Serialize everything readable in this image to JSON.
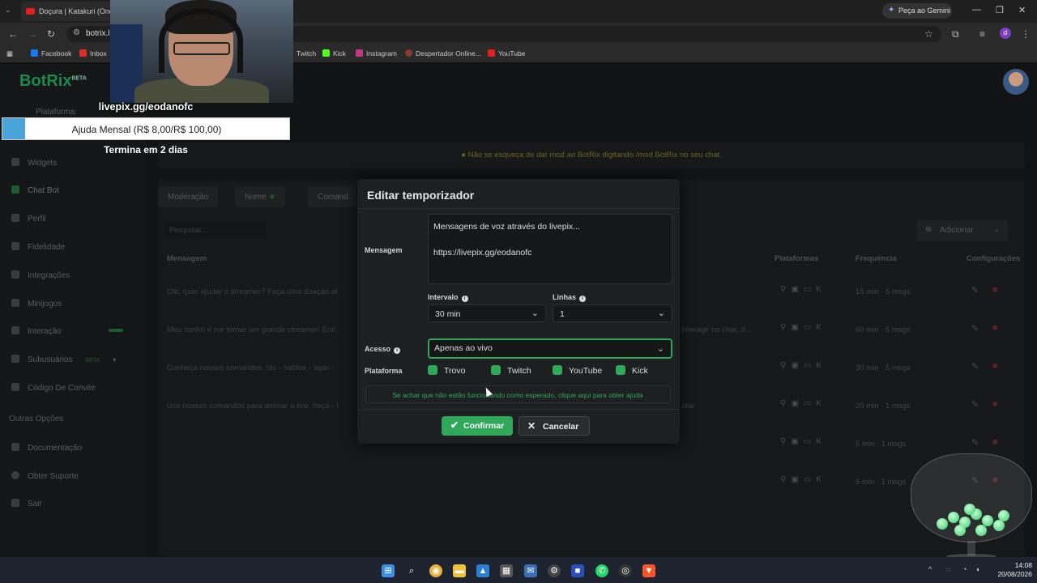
{
  "browser": {
    "tab_title": "Doçura | Katakuri (One P",
    "gemini_label": "Peça ao Gemini",
    "url": "botrix.li",
    "profile_initial": "d",
    "bookmarks": [
      "Facebook",
      "Inbox",
      "Twitch",
      "Kick",
      "Instagram",
      "Despertador Online...",
      "YouTube"
    ]
  },
  "overlay": {
    "livepix_label": "livepix.gg/eodanofc",
    "donation_goal": "Ajuda Mensal (R$ 8,00/R$ 100,00)",
    "donation_progress": 0.08,
    "ends_label": "Termina em 2 dias"
  },
  "app": {
    "logo": "BotRix",
    "logo_badge": "BETA",
    "platform_label": "Plataforma:",
    "sidebar": [
      "Widgets",
      "Chat Bot",
      "Perfil",
      "Fidelidade",
      "Integrações",
      "Minijogos",
      "Interação",
      "Subusuários",
      "Código De Convite"
    ],
    "subusers_badge": "BETA",
    "other_section": "Outras Opções",
    "other_items": [
      "Documentação",
      "Obter Suporte",
      "Sair"
    ],
    "banner": "Não se esqueça de dar mod ao BotRix digitando /mod BotRix no seu chat.",
    "tabs": [
      "Moderação",
      "Nome",
      "Comand"
    ],
    "search_placeholder": "Pesquisar...",
    "add_label": "Adicionar",
    "columns": [
      "Mensagem",
      "Plataformas",
      "Frequência",
      "Configurações"
    ],
    "rows": [
      {
        "msg": "Olá, quer ajudar o streamer? Faça uma doação at",
        "freq": "15 min · 5 msgs"
      },
      {
        "msg": "Meu sonho é me tornar um grande streamer! Entr",
        "extra": "interagir no chat, d...",
        "freq": "60 min · 5 msgs"
      },
      {
        "msg": "Conheça nossos comandos. !dc - !roblox - !epic -",
        "freq": "30 min · 5 msgs"
      },
      {
        "msg": "Use nossos comandos para animar a live. !roça - !",
        "extra": "afar",
        "freq": "20 min · 1 msgs"
      },
      {
        "msg": "",
        "freq": "5 min · 1 msgs"
      },
      {
        "msg": "",
        "freq": "5 min · 1 msgs"
      }
    ]
  },
  "modal": {
    "title": "Editar temporizador",
    "message_label": "Mensagem",
    "message_line1": "Mensagens de voz através do livepix...",
    "message_line2": "https://livepix.gg/eodanofc",
    "interval_label": "Intervalo",
    "interval_value": "30 min",
    "lines_label": "Linhas",
    "lines_value": "1",
    "access_label": "Acesso",
    "access_value": "Apenas ao vivo",
    "platform_label": "Plataforma",
    "platforms": [
      "Trovo",
      "Twitch",
      "YouTube",
      "Kick"
    ],
    "hint": "Se achar que não estão funcionando como esperado, clique aqui para obter ajuda",
    "confirm_label": "Confirmar",
    "cancel_label": "Cancelar"
  },
  "taskbar": {
    "time": "14:08",
    "date": "20/08/2026"
  },
  "colors": {
    "accent_green": "#2fa85a",
    "danger": "#5a2222"
  }
}
